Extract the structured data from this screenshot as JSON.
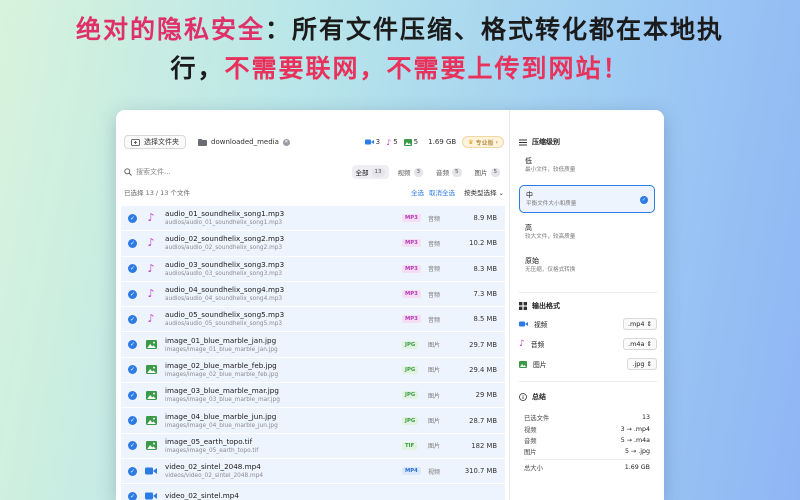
{
  "headline": {
    "line1_pink": "绝对的隐私安全",
    "line1_rest": "：所有文件压缩、格式转化都在本地执",
    "line2_start": "行，",
    "line2_red": "不需要联网，不需要上传到网站！"
  },
  "toolbar": {
    "select_files": "选择文件夹",
    "folder": "downloaded_media",
    "video_count": "3",
    "audio_count": "5",
    "image_count": "5",
    "total_size": "1.69 GB",
    "pro": "专业版"
  },
  "search": {
    "placeholder": "搜索文件..."
  },
  "filters": [
    {
      "label": "全部",
      "count": "13"
    },
    {
      "label": "视频",
      "count": "3"
    },
    {
      "label": "音频",
      "count": "5"
    },
    {
      "label": "图片",
      "count": "5"
    }
  ],
  "selection": {
    "status": "已选择 13 / 13 个文件",
    "select_all": "全选",
    "deselect_all": "取消全选",
    "sort": "按类型选择"
  },
  "files": [
    {
      "name": "audio_01_soundhelix_song1.mp3",
      "path": "audios/audio_01_soundhelix_song1.mp3",
      "ext": "MP3",
      "type": "音频",
      "size": "8.9 MB",
      "kind": "audio"
    },
    {
      "name": "audio_02_soundhelix_song2.mp3",
      "path": "audios/audio_02_soundhelix_song2.mp3",
      "ext": "MP3",
      "type": "音频",
      "size": "10.2 MB",
      "kind": "audio"
    },
    {
      "name": "audio_03_soundhelix_song3.mp3",
      "path": "audios/audio_03_soundhelix_song3.mp3",
      "ext": "MP3",
      "type": "音频",
      "size": "8.3 MB",
      "kind": "audio"
    },
    {
      "name": "audio_04_soundhelix_song4.mp3",
      "path": "audios/audio_04_soundhelix_song4.mp3",
      "ext": "MP3",
      "type": "音频",
      "size": "7.3 MB",
      "kind": "audio"
    },
    {
      "name": "audio_05_soundhelix_song5.mp3",
      "path": "audios/audio_05_soundhelix_song5.mp3",
      "ext": "MP3",
      "type": "音频",
      "size": "8.5 MB",
      "kind": "audio"
    },
    {
      "name": "image_01_blue_marble_jan.jpg",
      "path": "images/image_01_blue_marble_jan.jpg",
      "ext": "JPG",
      "type": "图片",
      "size": "29.7 MB",
      "kind": "image"
    },
    {
      "name": "image_02_blue_marble_feb.jpg",
      "path": "images/image_02_blue_marble_feb.jpg",
      "ext": "JPG",
      "type": "图片",
      "size": "29.4 MB",
      "kind": "image"
    },
    {
      "name": "image_03_blue_marble_mar.jpg",
      "path": "images/image_03_blue_marble_mar.jpg",
      "ext": "JPG",
      "type": "图片",
      "size": "29 MB",
      "kind": "image"
    },
    {
      "name": "image_04_blue_marble_jun.jpg",
      "path": "images/image_04_blue_marble_jun.jpg",
      "ext": "JPG",
      "type": "图片",
      "size": "28.7 MB",
      "kind": "image"
    },
    {
      "name": "image_05_earth_topo.tif",
      "path": "images/image_05_earth_topo.tif",
      "ext": "TIF",
      "type": "图片",
      "size": "182 MB",
      "kind": "image"
    },
    {
      "name": "video_02_sintel_2048.mp4",
      "path": "videos/video_02_sintel_2048.mp4",
      "ext": "MP4",
      "type": "视频",
      "size": "310.7 MB",
      "kind": "video"
    },
    {
      "name": "video_02_sintel.mp4",
      "path": "",
      "ext": "",
      "type": "",
      "size": "",
      "kind": "video"
    }
  ],
  "compression": {
    "title": "压缩级别",
    "options": [
      {
        "title": "低",
        "sub": "最小文件，较低质量"
      },
      {
        "title": "中",
        "sub": "平衡文件大小和质量"
      },
      {
        "title": "高",
        "sub": "较大文件，较高质量"
      },
      {
        "title": "原始",
        "sub": "无压缩，仅格式转换"
      }
    ]
  },
  "output": {
    "title": "输出格式",
    "video": {
      "label": "视频",
      "value": ".mp4"
    },
    "audio": {
      "label": "音频",
      "value": ".m4a"
    },
    "image": {
      "label": "图片",
      "value": ".jpg"
    }
  },
  "summary": {
    "title": "总结",
    "rows": [
      {
        "k": "已选文件",
        "v": "13"
      },
      {
        "k": "视频",
        "v": "3 → .mp4"
      },
      {
        "k": "音频",
        "v": "5 → .m4a"
      },
      {
        "k": "图片",
        "v": "5 → .jpg"
      },
      {
        "k": "总大小",
        "v": "1.69 GB"
      }
    ]
  },
  "colors": {
    "accent": "#2d7be5",
    "audio": "#c53fd0",
    "image": "#3a9a48",
    "video": "#2d7be5"
  }
}
